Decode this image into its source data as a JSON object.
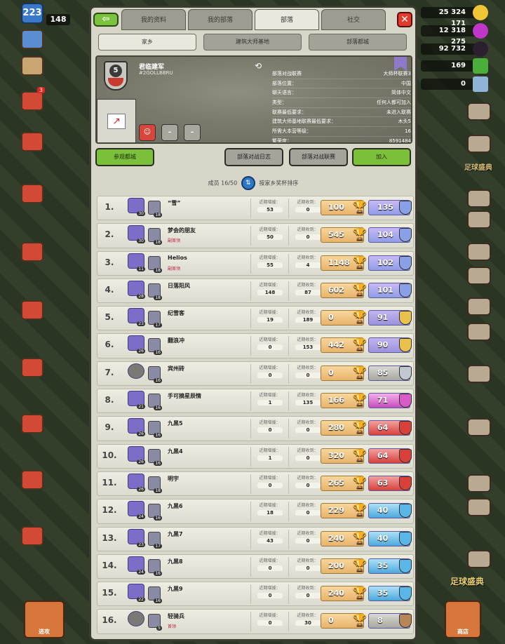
{
  "hud": {
    "player_level": "223",
    "player_trophies": "148",
    "gold": "25 324 171",
    "elixir": "12 318 275",
    "dark_elixir": "92 732",
    "builders": "169",
    "gems": "0",
    "left_badge": "3",
    "right_bottom_label": "商店",
    "left_bottom_label": "进攻",
    "right_label_1": "足球盛典",
    "right_label_2": "足球盛典"
  },
  "tabs": [
    "我的资料",
    "我的部落",
    "部落",
    "社交"
  ],
  "subtabs": [
    "家乡",
    "建筑大师基地",
    "部落都城"
  ],
  "clan": {
    "level": "5",
    "name": "君临建军",
    "tag": "#2GOLLBBRU",
    "properties": [
      {
        "label": "部落对战联赛",
        "value": "大师杯联赛3"
      },
      {
        "label": "部落位置：",
        "value": "中国"
      },
      {
        "label": "聊天语言：",
        "value": "简体中文"
      },
      {
        "label": "类型：",
        "value": "任何人都可加入"
      },
      {
        "label": "联赛最低要求：",
        "value": "未进入联赛"
      },
      {
        "label": "建筑大师基地联赛最低要求：",
        "value": "木头5"
      },
      {
        "label": "所需大本营等级：",
        "value": "16"
      },
      {
        "label": "繁荣度：",
        "value": "8591484"
      }
    ]
  },
  "actions": {
    "capital": "参观都城",
    "war_log": "部落对战日志",
    "league": "部落对战联赛",
    "join": "加入"
  },
  "members_line": {
    "count": "成员 16/50",
    "sort_label": "按家乡奖杯排序"
  },
  "stat_labels": {
    "donated": "近期增援：",
    "received": "近期收到："
  },
  "members": [
    {
      "rank": "1.",
      "th": "30",
      "bh": "18",
      "name": "“雪”",
      "role": "",
      "donated": "53",
      "received": "0",
      "builder_trophies": "100",
      "trophies": "135",
      "league": "legend",
      "league_color": "#8aa0e6"
    },
    {
      "rank": "2.",
      "th": "30",
      "bh": "18",
      "name": "梦会的朋友",
      "role": "副首领",
      "donated": "50",
      "received": "0",
      "builder_trophies": "545",
      "trophies": "104",
      "league": "legend",
      "league_color": "#8aa0e6"
    },
    {
      "rank": "3.",
      "th": "11",
      "bh": "18",
      "name": "Helios",
      "role": "副首领",
      "donated": "55",
      "received": "4",
      "builder_trophies": "1148",
      "trophies": "102",
      "league": "legend",
      "league_color": "#8aa0e6"
    },
    {
      "rank": "4.",
      "th": "28",
      "bh": "18",
      "name": "日落阳风",
      "role": "",
      "donated": "148",
      "received": "87",
      "builder_trophies": "602",
      "trophies": "101",
      "league": "legend",
      "league_color": "#8aa0e6"
    },
    {
      "rank": "5.",
      "th": "23",
      "bh": "17",
      "name": "纪雪客",
      "role": "",
      "donated": "19",
      "received": "189",
      "builder_trophies": "0",
      "trophies": "91",
      "league": "gold",
      "league_color": "#e8c24a"
    },
    {
      "rank": "6.",
      "th": "26",
      "bh": "16",
      "name": "翻浪冲",
      "role": "",
      "donated": "0",
      "received": "153",
      "builder_trophies": "442",
      "trophies": "90",
      "league": "gold",
      "league_color": "#e8c24a"
    },
    {
      "rank": "7.",
      "th": "",
      "bh": "16",
      "name": "宾州砖",
      "role": "",
      "donated": "0",
      "received": "0",
      "builder_trophies": "0",
      "trophies": "85",
      "league": "silver",
      "league_color": "#c2c8d2"
    },
    {
      "rank": "8.",
      "th": "21",
      "bh": "16",
      "name": "手可摘星辰情",
      "role": "",
      "donated": "1",
      "received": "135",
      "builder_trophies": "166",
      "trophies": "71",
      "league": "crystal",
      "league_color": "#d85cc8"
    },
    {
      "rank": "9.",
      "th": "26",
      "bh": "16",
      "name": "九黑5",
      "role": "",
      "donated": "0",
      "received": "0",
      "builder_trophies": "280",
      "trophies": "64",
      "league": "master",
      "league_color": "#d8403a"
    },
    {
      "rank": "10.",
      "th": "26",
      "bh": "16",
      "name": "九黑4",
      "role": "",
      "donated": "1",
      "received": "0",
      "builder_trophies": "320",
      "trophies": "64",
      "league": "master",
      "league_color": "#d8403a"
    },
    {
      "rank": "11.",
      "th": "26",
      "bh": "18",
      "name": "明宇",
      "role": "",
      "donated": "0",
      "received": "0",
      "builder_trophies": "265",
      "trophies": "63",
      "league": "master",
      "league_color": "#d8403a"
    },
    {
      "rank": "12.",
      "th": "24",
      "bh": "16",
      "name": "九黑6",
      "role": "",
      "donated": "18",
      "received": "0",
      "builder_trophies": "229",
      "trophies": "40",
      "league": "diamond",
      "league_color": "#5ab6e6"
    },
    {
      "rank": "13.",
      "th": "23",
      "bh": "17",
      "name": "九黑7",
      "role": "",
      "donated": "43",
      "received": "0",
      "builder_trophies": "240",
      "trophies": "40",
      "league": "diamond",
      "league_color": "#5ab6e6"
    },
    {
      "rank": "14.",
      "th": "24",
      "bh": "16",
      "name": "九黑8",
      "role": "",
      "donated": "0",
      "received": "0",
      "builder_trophies": "200",
      "trophies": "35",
      "league": "diamond",
      "league_color": "#5ab6e6"
    },
    {
      "rank": "15.",
      "th": "22",
      "bh": "16",
      "name": "九黑9",
      "role": "",
      "donated": "0",
      "received": "0",
      "builder_trophies": "240",
      "trophies": "35",
      "league": "diamond",
      "league_color": "#5ab6e6"
    },
    {
      "rank": "16.",
      "th": "",
      "bh": "5",
      "name": "轻骑兵",
      "role": "首领",
      "donated": "0",
      "received": "30",
      "builder_trophies": "0",
      "trophies": "8",
      "league": "bronze",
      "league_color": "#b68658"
    }
  ]
}
